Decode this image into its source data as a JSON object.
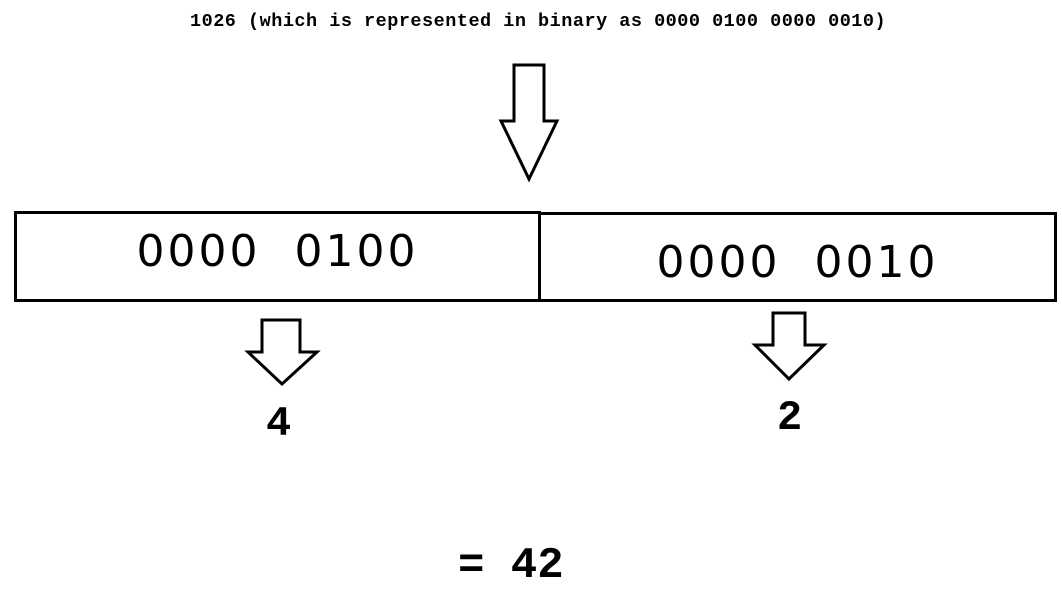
{
  "caption": "1026 (which is represented in binary as 0000 0100 0000 0010)",
  "high_byte": {
    "bits": "0000  0100",
    "value": "4"
  },
  "low_byte": {
    "bits": "0000  0010",
    "value": "2"
  },
  "result": "= 42"
}
